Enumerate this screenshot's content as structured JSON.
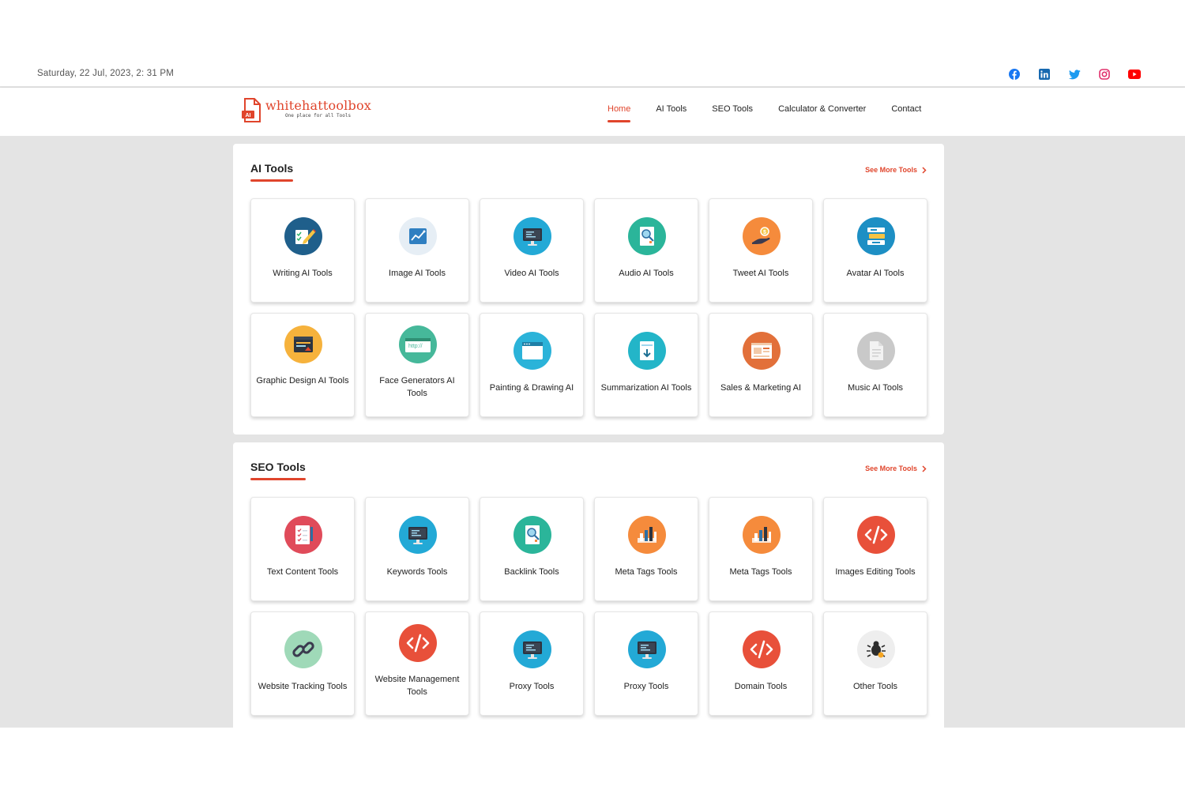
{
  "topbar": {
    "datetime": "Saturday, 22 Jul, 2023, 2: 31 PM",
    "socials": [
      "facebook-icon",
      "linkedin-icon",
      "twitter-icon",
      "instagram-icon",
      "youtube-icon"
    ]
  },
  "header": {
    "logo_title": "whitehattoolbox",
    "logo_tagline": "One place for all Tools",
    "logo_badge": "AI",
    "nav": [
      {
        "label": "Home",
        "active": true
      },
      {
        "label": "AI Tools",
        "active": false
      },
      {
        "label": "SEO Tools",
        "active": false
      },
      {
        "label": "Calculator & Converter",
        "active": false
      },
      {
        "label": "Contact",
        "active": false
      }
    ]
  },
  "ai_section": {
    "title": "AI Tools",
    "see_more": "See More Tools",
    "cards": [
      {
        "label": "Writing AI Tools",
        "icon": "writing-icon",
        "color": "#1f5f8b"
      },
      {
        "label": "Image AI Tools",
        "icon": "image-chart-icon",
        "color": "#e6eef5"
      },
      {
        "label": "Video AI Tools",
        "icon": "monitor-icon",
        "color": "#23a9d6"
      },
      {
        "label": "Audio AI Tools",
        "icon": "audio-doc-icon",
        "color": "#2bb59a"
      },
      {
        "label": "Tweet AI Tools",
        "icon": "hand-coin-icon",
        "color": "#f58b3c"
      },
      {
        "label": "Avatar AI Tools",
        "icon": "stack-icon",
        "color": "#1d8fc4"
      },
      {
        "label": "Graphic Design AI Tools",
        "icon": "design-window-icon",
        "color": "#f6b23c"
      },
      {
        "label": "Face Generators AI Tools",
        "icon": "browser-http-icon",
        "color": "#46b89a"
      },
      {
        "label": "Painting & Drawing AI",
        "icon": "browser-window-icon",
        "color": "#2bb3d9"
      },
      {
        "label": "Summarization AI Tools",
        "icon": "download-doc-icon",
        "color": "#23b5c8"
      },
      {
        "label": "Sales & Marketing AI",
        "icon": "webpage-icon",
        "color": "#e2703a"
      },
      {
        "label": "Music AI Tools",
        "icon": "file-icon",
        "color": "#c9c9c9"
      }
    ]
  },
  "seo_section": {
    "title": "SEO Tools",
    "see_more": "See More Tools",
    "cards": [
      {
        "label": "Text Content Tools",
        "icon": "checklist-icon",
        "color": "#e04b5a"
      },
      {
        "label": "Keywords Tools",
        "icon": "monitor-icon",
        "color": "#23a9d6"
      },
      {
        "label": "Backlink Tools",
        "icon": "audio-doc-icon",
        "color": "#2bb59a"
      },
      {
        "label": "Meta Tags Tools",
        "icon": "bar-chart-icon",
        "color": "#f58b3c"
      },
      {
        "label": "Meta Tags Tools",
        "icon": "bar-chart-icon",
        "color": "#f58b3c"
      },
      {
        "label": "Images Editing Tools",
        "icon": "code-icon",
        "color": "#e8503a"
      },
      {
        "label": "Website Tracking Tools",
        "icon": "link-icon",
        "color": "#9fd9b8"
      },
      {
        "label": "Website Management Tools",
        "icon": "code-icon",
        "color": "#e8503a"
      },
      {
        "label": "Proxy Tools",
        "icon": "monitor-icon",
        "color": "#23a9d6"
      },
      {
        "label": "Proxy Tools",
        "icon": "monitor-icon",
        "color": "#23a9d6"
      },
      {
        "label": "Domain Tools",
        "icon": "code-icon",
        "color": "#e8503a"
      },
      {
        "label": "Other Tools",
        "icon": "bug-icon",
        "color": "#eeeeee"
      }
    ]
  }
}
